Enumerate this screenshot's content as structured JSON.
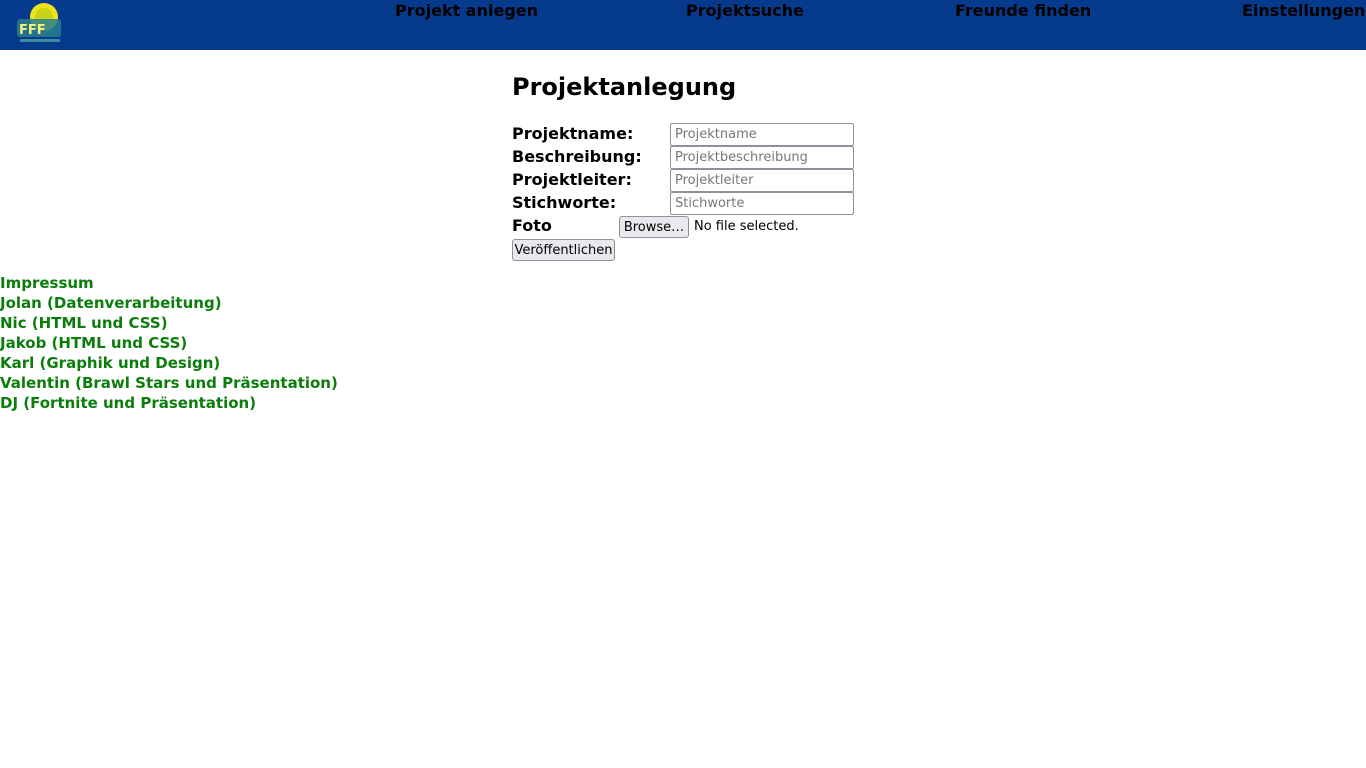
{
  "header": {
    "logo_icon": "fridays-for-future-logo-icon",
    "nav": [
      {
        "label": "Projekt anlegen"
      },
      {
        "label": "Projektsuche"
      },
      {
        "label": "Freunde finden"
      },
      {
        "label": "Einstellungen"
      }
    ],
    "background_color": "#063a8c"
  },
  "main": {
    "title": "Projektanlegung",
    "form": {
      "fields": [
        {
          "label": "Projektname:",
          "value": "",
          "placeholder": "Projektname"
        },
        {
          "label": "Beschreibung:",
          "value": "",
          "placeholder": "Projektbeschreibung"
        },
        {
          "label": "Projektleiter:",
          "value": "",
          "placeholder": "Projektleiter"
        },
        {
          "label": "Stichworte:",
          "value": "",
          "placeholder": "Stichworte"
        }
      ],
      "photo": {
        "label": "Foto",
        "browse_label": "Browse…",
        "status": "No file selected."
      },
      "submit_label": "Veröffentlichen"
    }
  },
  "footer": {
    "link_color": "#0a7d0a",
    "links": [
      {
        "label": "Impressum"
      },
      {
        "label": "Jolan (Datenverarbeitung)"
      },
      {
        "label": "Nic (HTML und CSS)"
      },
      {
        "label": "Jakob (HTML und CSS)"
      },
      {
        "label": "Karl (Graphik und Design)"
      },
      {
        "label": "Valentin (Brawl Stars und Präsentation)"
      },
      {
        "label": "DJ (Fortnite und Präsentation)"
      }
    ]
  }
}
